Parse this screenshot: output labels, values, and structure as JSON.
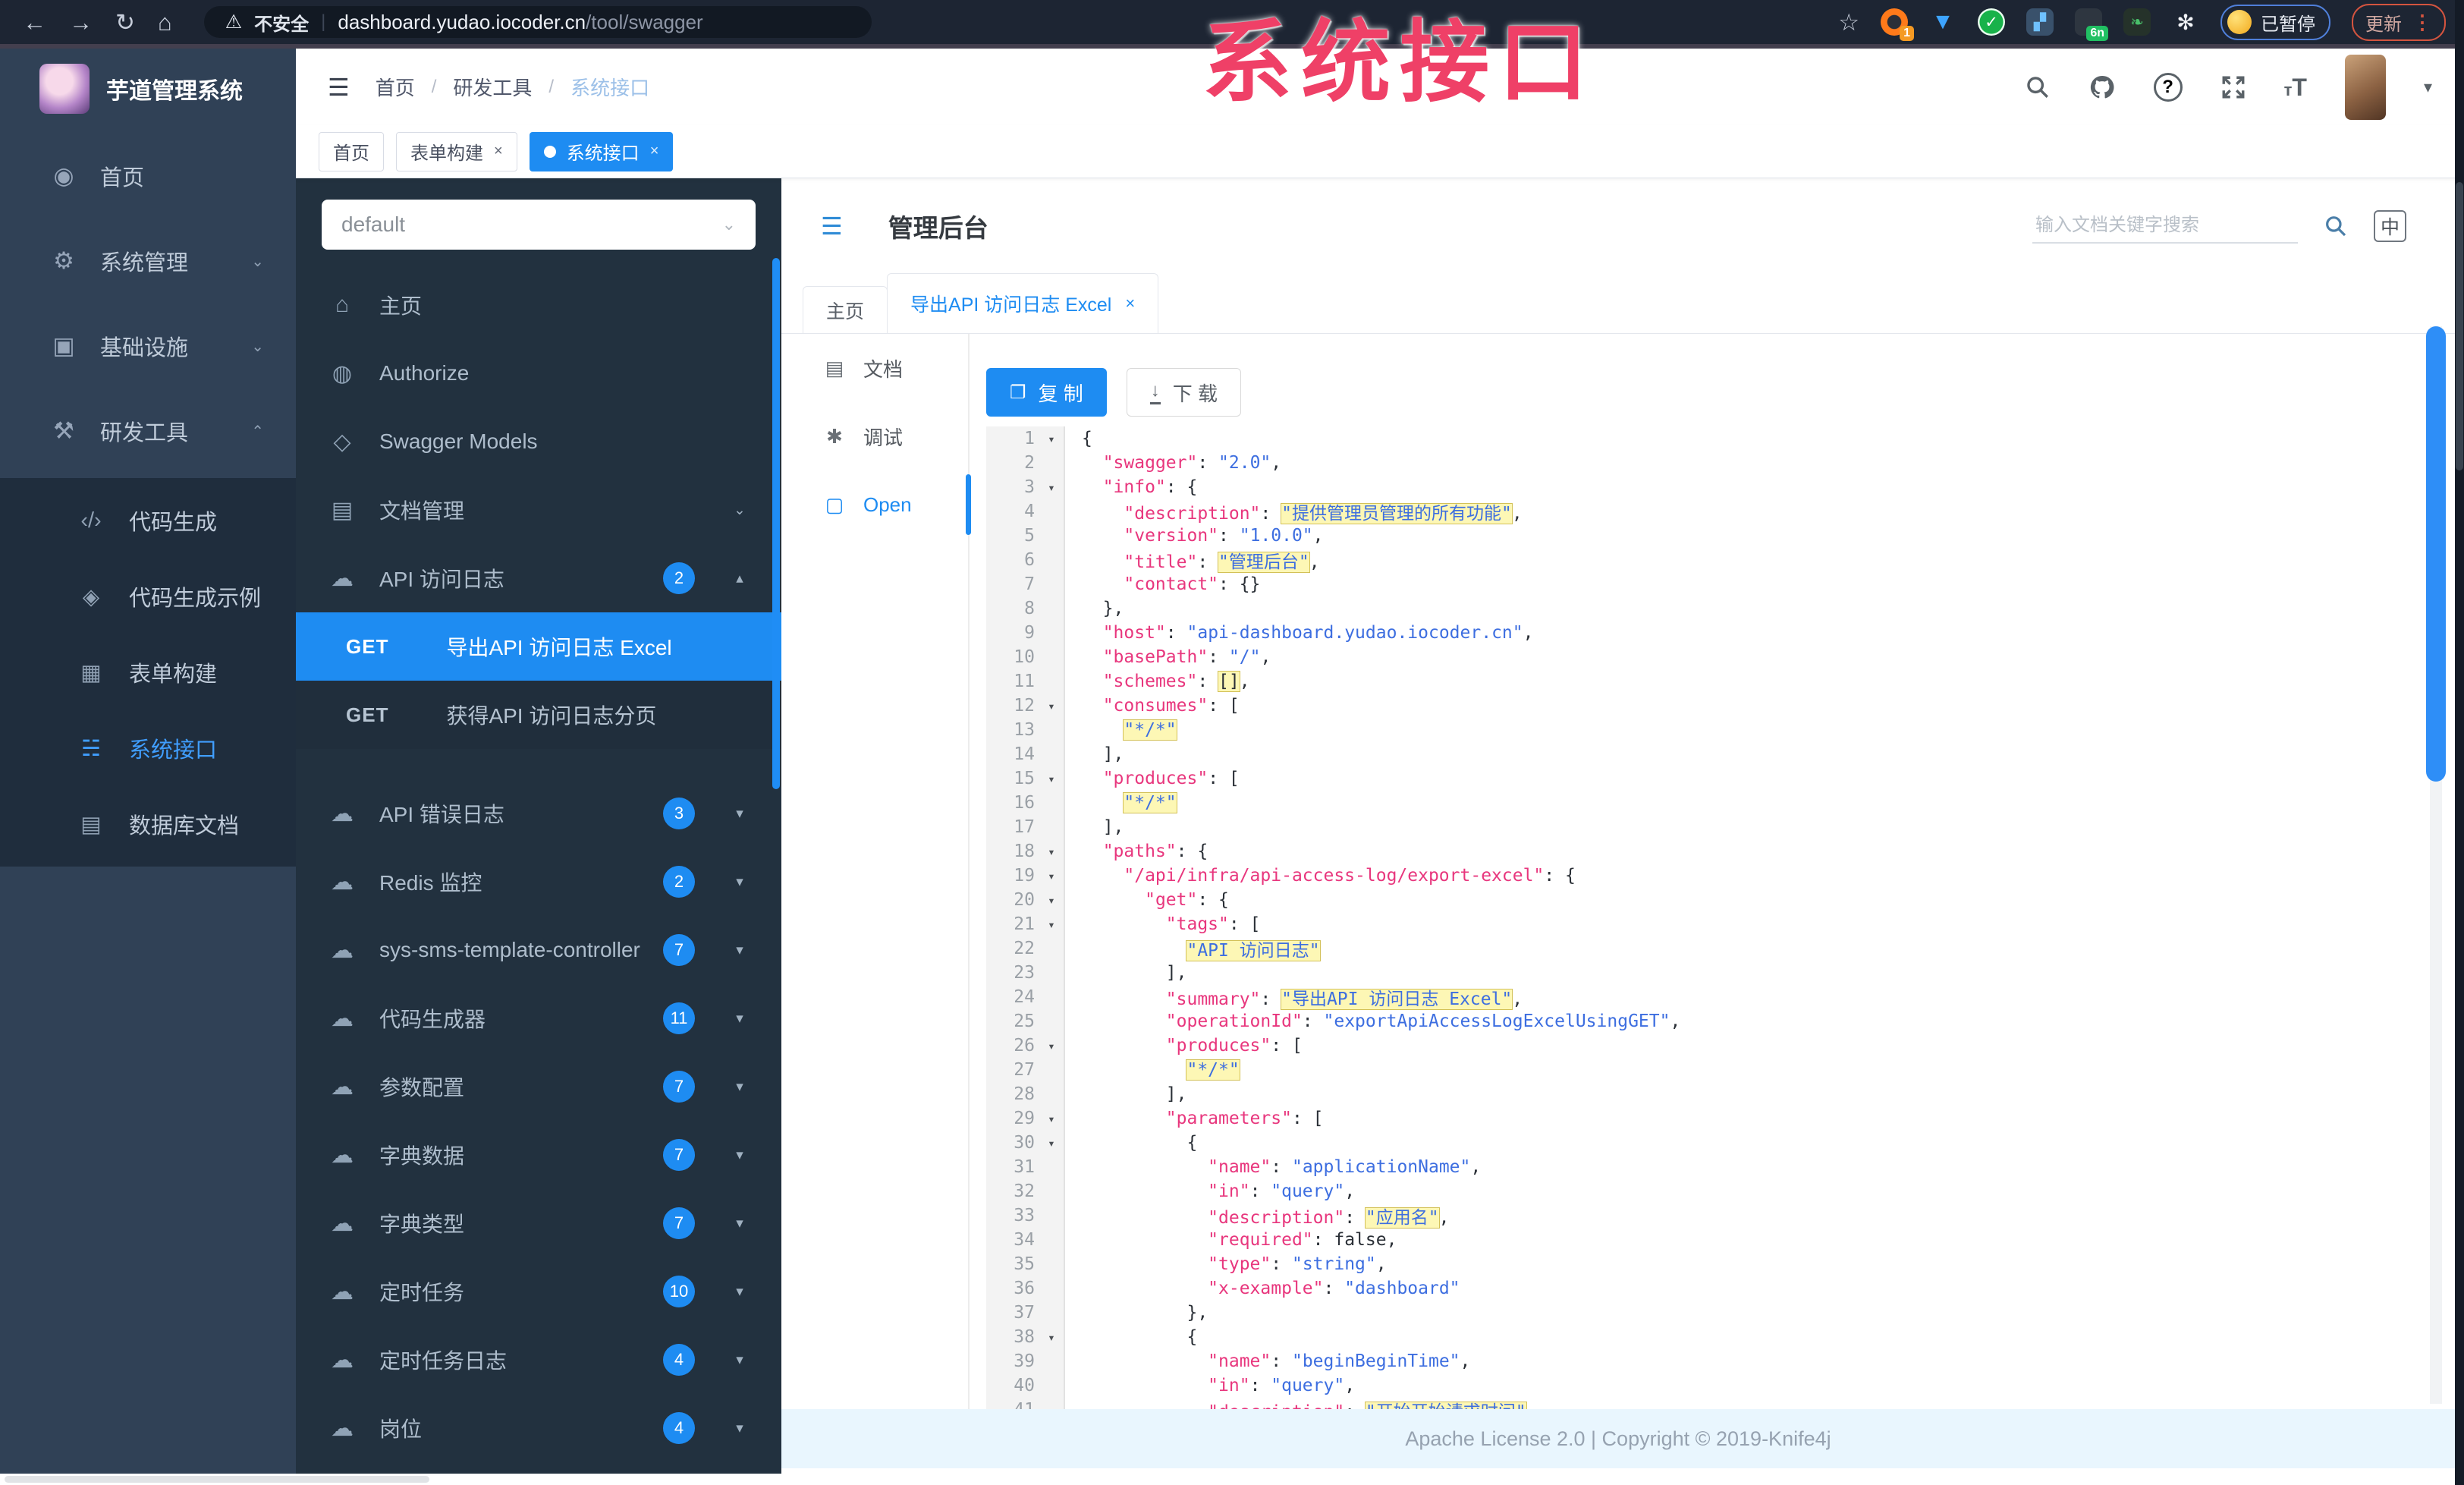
{
  "colors": {
    "accent_blue": "#1e8cf2",
    "sidebar_bg": "#304156",
    "active_menu_blue": "#409eff",
    "key_pink": "#e8367d",
    "string_blue": "#3d6ee0",
    "watermark_pink": "#ef4067",
    "footer_bg": "#e9f6fe"
  },
  "watermark": "系统接口",
  "browser": {
    "security_label": "不安全",
    "url_host": "dashboard.yudao.iocoder.cn",
    "url_path": "/tool/swagger",
    "paused_label": "已暂停",
    "update_label": "更新",
    "ext_badge_one": "1",
    "ext_badge_6n": "6n"
  },
  "sidebar": {
    "logo_title": "芋道管理系统",
    "items": [
      {
        "label": "首页",
        "icon": "dashboard-icon",
        "glyph": "◉",
        "arrow": ""
      },
      {
        "label": "系统管理",
        "icon": "gear-icon",
        "glyph": "⚙",
        "arrow": "down"
      },
      {
        "label": "基础设施",
        "icon": "monitor-icon",
        "glyph": "▣",
        "arrow": "down"
      },
      {
        "label": "研发工具",
        "icon": "toolbox-icon",
        "glyph": "⚒",
        "arrow": "up"
      }
    ],
    "submenu": [
      {
        "label": "代码生成",
        "icon": "code-icon",
        "glyph": "‹/›",
        "active": false
      },
      {
        "label": "代码生成示例",
        "icon": "shield-check-icon",
        "glyph": "◈",
        "active": false
      },
      {
        "label": "表单构建",
        "icon": "form-builder-icon",
        "glyph": "▦",
        "active": false
      },
      {
        "label": "系统接口",
        "icon": "api-icon",
        "glyph": "☵",
        "active": true
      },
      {
        "label": "数据库文档",
        "icon": "database-doc-icon",
        "glyph": "▤",
        "active": false
      }
    ]
  },
  "header": {
    "breadcrumb": [
      "首页",
      "研发工具",
      "系统接口"
    ]
  },
  "tags": [
    {
      "label": "首页",
      "closable": false,
      "active": false
    },
    {
      "label": "表单构建",
      "closable": true,
      "active": false
    },
    {
      "label": "系统接口",
      "closable": true,
      "active": true
    }
  ],
  "docmenu": {
    "group_select": "default",
    "items": [
      {
        "label": "主页",
        "icon": "home-icon",
        "glyph": "⌂",
        "arrow": ""
      },
      {
        "label": "Authorize",
        "icon": "authorize-icon",
        "glyph": "◍",
        "arrow": ""
      },
      {
        "label": "Swagger Models",
        "icon": "models-icon",
        "glyph": "◇",
        "arrow": ""
      },
      {
        "label": "文档管理",
        "icon": "doc-manage-icon",
        "glyph": "▤",
        "arrow": "down"
      }
    ],
    "api_group": {
      "label": "API 访问日志",
      "icon": "cloud-icon",
      "glyph": "☁",
      "badge": "2",
      "arrow": "up",
      "children": [
        {
          "method": "GET",
          "label": "导出API 访问日志 Excel",
          "active": true
        },
        {
          "method": "GET",
          "label": "获得API 访问日志分页",
          "active": false
        }
      ]
    },
    "groups": [
      {
        "label": "API 错误日志",
        "icon": "cloud-icon",
        "glyph": "☁",
        "badge": "3"
      },
      {
        "label": "Redis 监控",
        "icon": "cloud-icon",
        "glyph": "☁",
        "badge": "2"
      },
      {
        "label": "sys-sms-template-controller",
        "icon": "cloud-icon",
        "glyph": "☁",
        "badge": "7"
      },
      {
        "label": "代码生成器",
        "icon": "cloud-icon",
        "glyph": "☁",
        "badge": "11"
      },
      {
        "label": "参数配置",
        "icon": "cloud-icon",
        "glyph": "☁",
        "badge": "7"
      },
      {
        "label": "字典数据",
        "icon": "cloud-icon",
        "glyph": "☁",
        "badge": "7"
      },
      {
        "label": "字典类型",
        "icon": "cloud-icon",
        "glyph": "☁",
        "badge": "7"
      },
      {
        "label": "定时任务",
        "icon": "cloud-icon",
        "glyph": "☁",
        "badge": "10"
      },
      {
        "label": "定时任务日志",
        "icon": "cloud-icon",
        "glyph": "☁",
        "badge": "4"
      },
      {
        "label": "岗位",
        "icon": "cloud-icon",
        "glyph": "☁",
        "badge": "4"
      }
    ]
  },
  "content": {
    "title": "管理后台",
    "search_placeholder": "输入文档关键字搜索",
    "lang_toggle": "中",
    "tabs": [
      {
        "label": "主页",
        "closable": false,
        "active": false
      },
      {
        "label": "导出API 访问日志 Excel",
        "closable": true,
        "active": true
      }
    ],
    "doc_nav": [
      {
        "label": "文档",
        "icon": "document-icon",
        "glyph": "▤",
        "active": false
      },
      {
        "label": "调试",
        "icon": "debug-icon",
        "glyph": "✱",
        "active": false
      },
      {
        "label": "Open",
        "icon": "open-file-icon",
        "glyph": "▢",
        "active": true
      }
    ],
    "copy_button": "复 制",
    "download_button": "下 载",
    "footer": "Apache License 2.0 | Copyright © 2019-Knife4j"
  },
  "editor": {
    "lines": [
      {
        "n": 1,
        "i": 0,
        "f": true,
        "s": [
          [
            "{",
            "p"
          ]
        ]
      },
      {
        "n": 2,
        "i": 1,
        "f": false,
        "s": [
          [
            "\"swagger\"",
            "k"
          ],
          [
            ": ",
            "p"
          ],
          [
            "\"2.0\"",
            "s"
          ],
          [
            ",",
            "p"
          ]
        ]
      },
      {
        "n": 3,
        "i": 1,
        "f": true,
        "s": [
          [
            "\"info\"",
            "k"
          ],
          [
            ": {",
            "p"
          ]
        ]
      },
      {
        "n": 4,
        "i": 2,
        "f": false,
        "s": [
          [
            "\"description\"",
            "k"
          ],
          [
            ": ",
            "p"
          ],
          [
            "\"提供管理员管理的所有功能\"",
            "s hl"
          ],
          [
            ",",
            "p"
          ]
        ]
      },
      {
        "n": 5,
        "i": 2,
        "f": false,
        "s": [
          [
            "\"version\"",
            "k"
          ],
          [
            ": ",
            "p"
          ],
          [
            "\"1.0.0\"",
            "s"
          ],
          [
            ",",
            "p"
          ]
        ]
      },
      {
        "n": 6,
        "i": 2,
        "f": false,
        "s": [
          [
            "\"title\"",
            "k"
          ],
          [
            ": ",
            "p"
          ],
          [
            "\"管理后台\"",
            "s hl"
          ],
          [
            ",",
            "p"
          ]
        ]
      },
      {
        "n": 7,
        "i": 2,
        "f": false,
        "s": [
          [
            "\"contact\"",
            "k"
          ],
          [
            ": {}",
            "p"
          ]
        ]
      },
      {
        "n": 8,
        "i": 1,
        "f": false,
        "s": [
          [
            "},",
            "p"
          ]
        ]
      },
      {
        "n": 9,
        "i": 1,
        "f": false,
        "s": [
          [
            "\"host\"",
            "k"
          ],
          [
            ": ",
            "p"
          ],
          [
            "\"api-dashboard.yudao.iocoder.cn\"",
            "s"
          ],
          [
            ",",
            "p"
          ]
        ]
      },
      {
        "n": 10,
        "i": 1,
        "f": false,
        "s": [
          [
            "\"basePath\"",
            "k"
          ],
          [
            ": ",
            "p"
          ],
          [
            "\"/\"",
            "s"
          ],
          [
            ",",
            "p"
          ]
        ]
      },
      {
        "n": 11,
        "i": 1,
        "f": false,
        "s": [
          [
            "\"schemes\"",
            "k"
          ],
          [
            ": ",
            "p"
          ],
          [
            "[]",
            "p hl"
          ],
          [
            ",",
            "p"
          ]
        ]
      },
      {
        "n": 12,
        "i": 1,
        "f": true,
        "s": [
          [
            "\"consumes\"",
            "k"
          ],
          [
            ": [",
            "p"
          ]
        ]
      },
      {
        "n": 13,
        "i": 2,
        "f": false,
        "s": [
          [
            "\"*/*\"",
            "s hl"
          ]
        ]
      },
      {
        "n": 14,
        "i": 1,
        "f": false,
        "s": [
          [
            "],",
            "p"
          ]
        ]
      },
      {
        "n": 15,
        "i": 1,
        "f": true,
        "s": [
          [
            "\"produces\"",
            "k"
          ],
          [
            ": [",
            "p"
          ]
        ]
      },
      {
        "n": 16,
        "i": 2,
        "f": false,
        "s": [
          [
            "\"*/*\"",
            "s hl"
          ]
        ]
      },
      {
        "n": 17,
        "i": 1,
        "f": false,
        "s": [
          [
            "],",
            "p"
          ]
        ]
      },
      {
        "n": 18,
        "i": 1,
        "f": true,
        "s": [
          [
            "\"paths\"",
            "k"
          ],
          [
            ": {",
            "p"
          ]
        ]
      },
      {
        "n": 19,
        "i": 2,
        "f": true,
        "s": [
          [
            "\"/api/infra/api-access-log/export-excel\"",
            "k"
          ],
          [
            ": {",
            "p"
          ]
        ]
      },
      {
        "n": 20,
        "i": 3,
        "f": true,
        "s": [
          [
            "\"get\"",
            "k"
          ],
          [
            ": {",
            "p"
          ]
        ]
      },
      {
        "n": 21,
        "i": 4,
        "f": true,
        "s": [
          [
            "\"tags\"",
            "k"
          ],
          [
            ": [",
            "p"
          ]
        ]
      },
      {
        "n": 22,
        "i": 5,
        "f": false,
        "s": [
          [
            "\"API 访问日志\"",
            "s hl"
          ]
        ]
      },
      {
        "n": 23,
        "i": 4,
        "f": false,
        "s": [
          [
            "],",
            "p"
          ]
        ]
      },
      {
        "n": 24,
        "i": 4,
        "f": false,
        "s": [
          [
            "\"summary\"",
            "k"
          ],
          [
            ": ",
            "p"
          ],
          [
            "\"导出API 访问日志 Excel\"",
            "s hl"
          ],
          [
            ",",
            "p"
          ]
        ]
      },
      {
        "n": 25,
        "i": 4,
        "f": false,
        "s": [
          [
            "\"operationId\"",
            "k"
          ],
          [
            ": ",
            "p"
          ],
          [
            "\"exportApiAccessLogExcelUsingGET\"",
            "s"
          ],
          [
            ",",
            "p"
          ]
        ]
      },
      {
        "n": 26,
        "i": 4,
        "f": true,
        "s": [
          [
            "\"produces\"",
            "k"
          ],
          [
            ": [",
            "p"
          ]
        ]
      },
      {
        "n": 27,
        "i": 5,
        "f": false,
        "s": [
          [
            "\"*/*\"",
            "s hl"
          ]
        ]
      },
      {
        "n": 28,
        "i": 4,
        "f": false,
        "s": [
          [
            "],",
            "p"
          ]
        ]
      },
      {
        "n": 29,
        "i": 4,
        "f": true,
        "s": [
          [
            "\"parameters\"",
            "k"
          ],
          [
            ": [",
            "p"
          ]
        ]
      },
      {
        "n": 30,
        "i": 5,
        "f": true,
        "s": [
          [
            "{",
            "p"
          ]
        ]
      },
      {
        "n": 31,
        "i": 6,
        "f": false,
        "s": [
          [
            "\"name\"",
            "k"
          ],
          [
            ": ",
            "p"
          ],
          [
            "\"applicationName\"",
            "s"
          ],
          [
            ",",
            "p"
          ]
        ]
      },
      {
        "n": 32,
        "i": 6,
        "f": false,
        "s": [
          [
            "\"in\"",
            "k"
          ],
          [
            ": ",
            "p"
          ],
          [
            "\"query\"",
            "s"
          ],
          [
            ",",
            "p"
          ]
        ]
      },
      {
        "n": 33,
        "i": 6,
        "f": false,
        "s": [
          [
            "\"description\"",
            "k"
          ],
          [
            ": ",
            "p"
          ],
          [
            "\"应用名\"",
            "s hl"
          ],
          [
            ",",
            "p"
          ]
        ]
      },
      {
        "n": 34,
        "i": 6,
        "f": false,
        "s": [
          [
            "\"required\"",
            "k"
          ],
          [
            ": ",
            "p"
          ],
          [
            "false",
            "b"
          ],
          [
            ",",
            "p"
          ]
        ]
      },
      {
        "n": 35,
        "i": 6,
        "f": false,
        "s": [
          [
            "\"type\"",
            "k"
          ],
          [
            ": ",
            "p"
          ],
          [
            "\"string\"",
            "s"
          ],
          [
            ",",
            "p"
          ]
        ]
      },
      {
        "n": 36,
        "i": 6,
        "f": false,
        "s": [
          [
            "\"x-example\"",
            "k"
          ],
          [
            ": ",
            "p"
          ],
          [
            "\"dashboard\"",
            "s"
          ]
        ]
      },
      {
        "n": 37,
        "i": 5,
        "f": false,
        "s": [
          [
            "},",
            "p"
          ]
        ]
      },
      {
        "n": 38,
        "i": 5,
        "f": true,
        "s": [
          [
            "{",
            "p"
          ]
        ]
      },
      {
        "n": 39,
        "i": 6,
        "f": false,
        "s": [
          [
            "\"name\"",
            "k"
          ],
          [
            ": ",
            "p"
          ],
          [
            "\"beginBeginTime\"",
            "s"
          ],
          [
            ",",
            "p"
          ]
        ]
      },
      {
        "n": 40,
        "i": 6,
        "f": false,
        "s": [
          [
            "\"in\"",
            "k"
          ],
          [
            ": ",
            "p"
          ],
          [
            "\"query\"",
            "s"
          ],
          [
            ",",
            "p"
          ]
        ]
      },
      {
        "n": 41,
        "i": 6,
        "f": false,
        "s": [
          [
            "\"description\"",
            "k"
          ],
          [
            ": ",
            "p"
          ],
          [
            "\"开始开始请求时间\"",
            "s hl"
          ]
        ]
      }
    ]
  }
}
